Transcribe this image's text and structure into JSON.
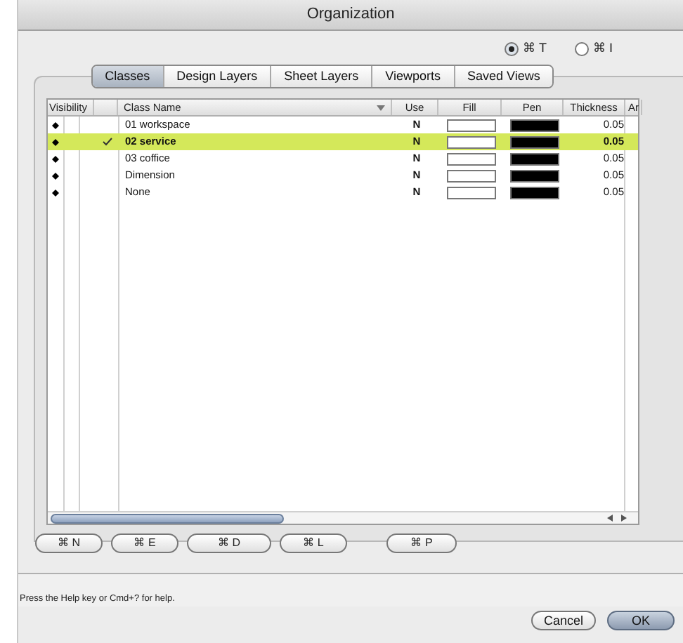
{
  "window": {
    "title": "Organization"
  },
  "mode_options": [
    {
      "label": "⌘ T",
      "selected": true
    },
    {
      "label": "⌘ I",
      "selected": false
    }
  ],
  "tabs": [
    {
      "label": "Classes",
      "selected": true
    },
    {
      "label": "Design Layers",
      "selected": false
    },
    {
      "label": "Sheet Layers",
      "selected": false
    },
    {
      "label": "Viewports",
      "selected": false
    },
    {
      "label": "Saved Views",
      "selected": false
    }
  ],
  "table": {
    "columns": [
      "Visibility",
      "Class Name",
      "Use",
      "Fill",
      "Pen",
      "Thickness",
      "Ar"
    ],
    "rows": [
      {
        "name": "01 workspace",
        "use": "N",
        "thickness": "0.05",
        "selected": false,
        "active": false
      },
      {
        "name": "02 service",
        "use": "N",
        "thickness": "0.05",
        "selected": true,
        "active": true
      },
      {
        "name": "03 coffice",
        "use": "N",
        "thickness": "0.05",
        "selected": false,
        "active": false
      },
      {
        "name": "Dimension",
        "use": "N",
        "thickness": "0.05",
        "selected": false,
        "active": false
      },
      {
        "name": "None",
        "use": "N",
        "thickness": "0.05",
        "selected": false,
        "active": false
      }
    ]
  },
  "action_buttons": [
    "⌘ N",
    "⌘ E",
    "⌘ D",
    "⌘ L",
    "⌘ P"
  ],
  "status_bar": "Press the Help key or Cmd+? for help.",
  "buttons": [
    {
      "label": "Cancel",
      "default": false
    },
    {
      "label": "OK",
      "default": true
    }
  ]
}
